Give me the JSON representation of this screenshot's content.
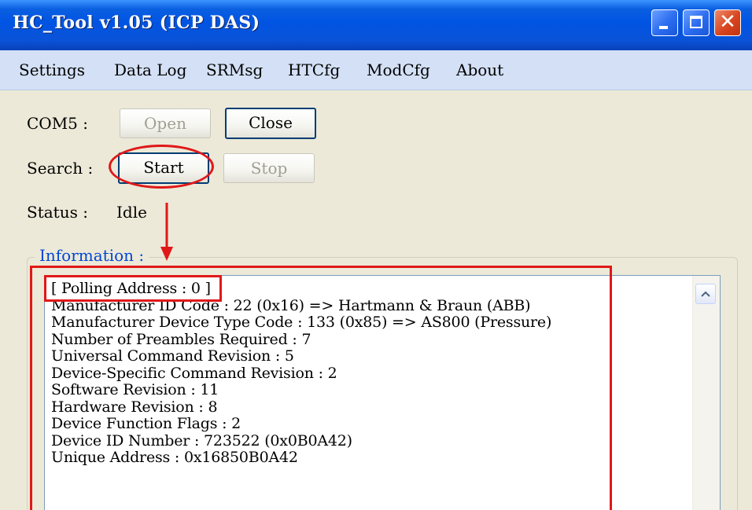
{
  "window": {
    "title": "HC_Tool v1.05  (ICP DAS)",
    "controls": {
      "minimize_icon": "minimize-icon",
      "maximize_icon": "maximize-icon",
      "close_icon": "close-icon",
      "close_glyph": "✕"
    }
  },
  "menu": {
    "items": [
      {
        "label": "Settings"
      },
      {
        "label": "Data Log"
      },
      {
        "label": "SRMsg"
      },
      {
        "label": "HTCfg"
      },
      {
        "label": "ModCfg"
      },
      {
        "label": "About"
      }
    ]
  },
  "com": {
    "label": "COM5 :",
    "open_button": "Open",
    "close_button": "Close"
  },
  "search": {
    "label": "Search :",
    "start_button": "Start",
    "stop_button": "Stop"
  },
  "status": {
    "label": "Status :",
    "value": "Idle"
  },
  "information": {
    "legend": "Information :",
    "lines": [
      "[ Polling Address : 0 ]",
      "Manufacturer ID Code : 22 (0x16) => Hartmann & Braun (ABB)",
      "Manufacturer Device Type Code : 133 (0x85) => AS800 (Pressure)",
      "Number of Preambles Required : 7",
      "Universal Command Revision : 5",
      "Device-Specific Command Revision : 2",
      "Software Revision : 11",
      "Hardware Revision : 8",
      "Device Function Flags : 2",
      "Device ID Number : 723522 (0x0B0A42)",
      "Unique Address : 0x16850B0A42"
    ]
  },
  "colors": {
    "title_bar": "#0054e3",
    "menu_bar": "#d3e0f5",
    "window_bg": "#ece9d8",
    "annotation": "#e01818",
    "group_legend": "#0046d5"
  }
}
